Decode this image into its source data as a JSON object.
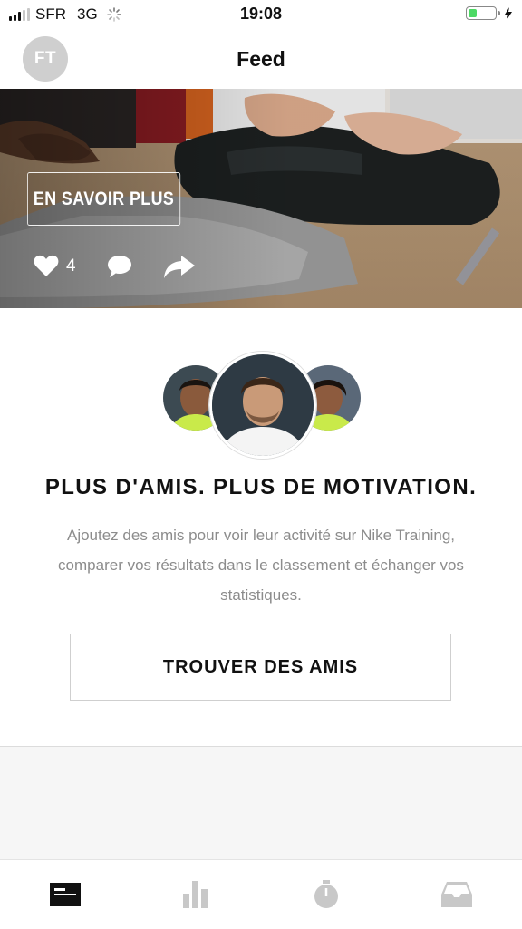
{
  "status_bar": {
    "carrier": "SFR",
    "network": "3G",
    "time": "19:08"
  },
  "nav": {
    "avatar_initials": "FT",
    "title": "Feed"
  },
  "hero": {
    "cta_label": "EN SAVOIR PLUS",
    "like_count": "4"
  },
  "social": {
    "title": "PLUS D'AMIS. PLUS DE MOTIVATION.",
    "body": "Ajoutez des amis pour voir leur activité sur Nike Training, comparer vos résultats dans le classement et échanger vos statistiques.",
    "button_label": "TROUVER DES AMIS"
  },
  "tabbar": {
    "tabs": [
      {
        "icon": "feed-icon",
        "active": true
      },
      {
        "icon": "activity-chart-icon",
        "active": false
      },
      {
        "icon": "stopwatch-icon",
        "active": false
      },
      {
        "icon": "inbox-icon",
        "active": false
      }
    ]
  },
  "colors": {
    "active_tab": "#111111",
    "inactive_tab": "#c8c8c8",
    "battery_fill": "#4cd964"
  }
}
